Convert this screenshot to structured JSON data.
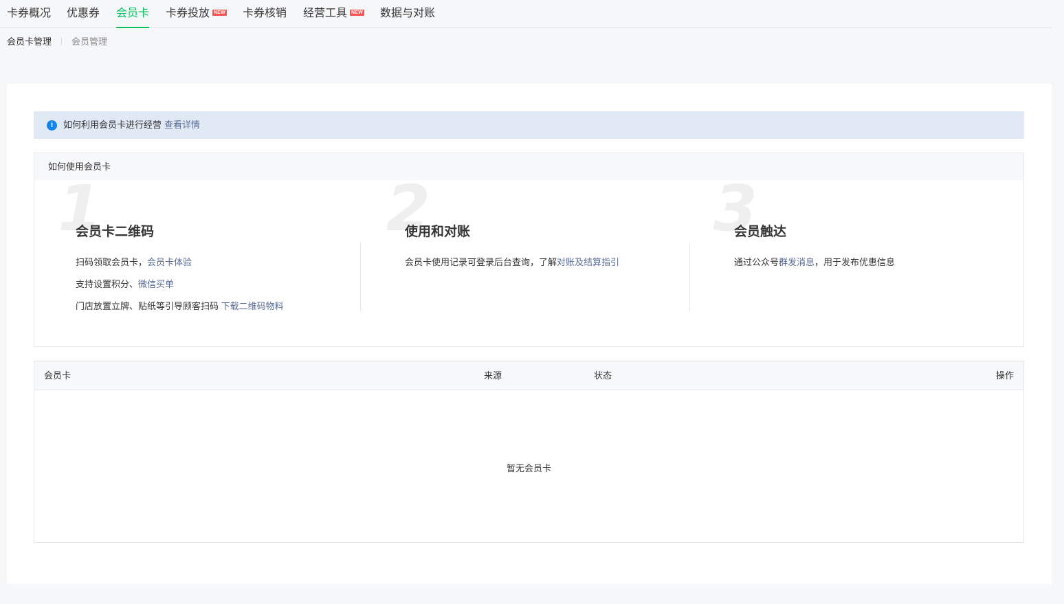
{
  "topnav": {
    "tabs": [
      {
        "label": "卡券概况",
        "active": false,
        "badge": ""
      },
      {
        "label": "优惠券",
        "active": false,
        "badge": ""
      },
      {
        "label": "会员卡",
        "active": true,
        "badge": ""
      },
      {
        "label": "卡券投放",
        "active": false,
        "badge": "NEW"
      },
      {
        "label": "卡券核销",
        "active": false,
        "badge": ""
      },
      {
        "label": "经营工具",
        "active": false,
        "badge": "NEW"
      },
      {
        "label": "数据与对账",
        "active": false,
        "badge": ""
      }
    ]
  },
  "subnav": {
    "items": [
      {
        "label": "会员卡管理",
        "active": true
      },
      {
        "label": "会员管理",
        "active": false
      }
    ]
  },
  "tips": {
    "icon": "info-icon",
    "text": "如何利用会员卡进行经营",
    "link": "查看详情"
  },
  "guide": {
    "header": "如何使用会员卡",
    "steps": [
      {
        "number": "1",
        "title": "会员卡二维码",
        "lines": [
          {
            "text": "扫码领取会员卡，",
            "link": "会员卡体验"
          },
          {
            "text": "支持设置积分、",
            "link": "微信买单"
          },
          {
            "text": "门店放置立牌、贴纸等引导顾客扫码 ",
            "link": "下载二维码物料"
          }
        ]
      },
      {
        "number": "2",
        "title": "使用和对账",
        "lines": [
          {
            "text": "会员卡使用记录可登录后台查询，了解",
            "link": "对账及结算指引"
          }
        ]
      },
      {
        "number": "3",
        "title": "会员触达",
        "lines": [
          {
            "text": "通过公众号",
            "link": "群发消息",
            "after": "，用于发布优惠信息"
          }
        ]
      }
    ]
  },
  "table": {
    "columns": [
      "会员卡",
      "来源",
      "状态",
      "操作"
    ],
    "empty_text": "暂无会员卡"
  },
  "colors": {
    "accent": "#07c160",
    "link": "#576b95",
    "badge": "#fa5151",
    "info_bg": "#e1e9f5",
    "info_icon": "#1485ee"
  }
}
